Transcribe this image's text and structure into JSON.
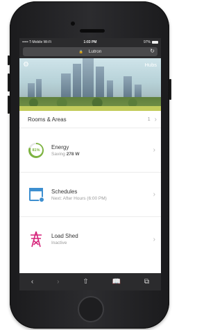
{
  "status_bar": {
    "carrier": "••••• T-Mobile Wi-Fi",
    "time": "1:03 PM",
    "battery": "97%"
  },
  "url_bar": {
    "site": "Lutron"
  },
  "hero": {
    "hubs_label": "Hubs"
  },
  "rooms": {
    "label": "Rooms & Areas",
    "count": "1"
  },
  "items": [
    {
      "title": "Energy",
      "subtitle_prefix": "Saving",
      "subtitle_value": "278 W",
      "gauge_percent": 81,
      "gauge_label": "81%"
    },
    {
      "title": "Schedules",
      "subtitle": "Next: After Hours (6:00 PM)"
    },
    {
      "title": "Load Shed",
      "subtitle": "Inactive"
    }
  ],
  "colors": {
    "accent_green": "#7db341",
    "accent_blue": "#3d8fd0",
    "accent_magenta": "#d6237a"
  },
  "icons": [
    "settings-icon",
    "energy-gauge-icon",
    "calendar-icon",
    "transmission-tower-icon",
    "back-icon",
    "forward-icon",
    "share-icon",
    "bookmarks-icon",
    "tabs-icon"
  ]
}
